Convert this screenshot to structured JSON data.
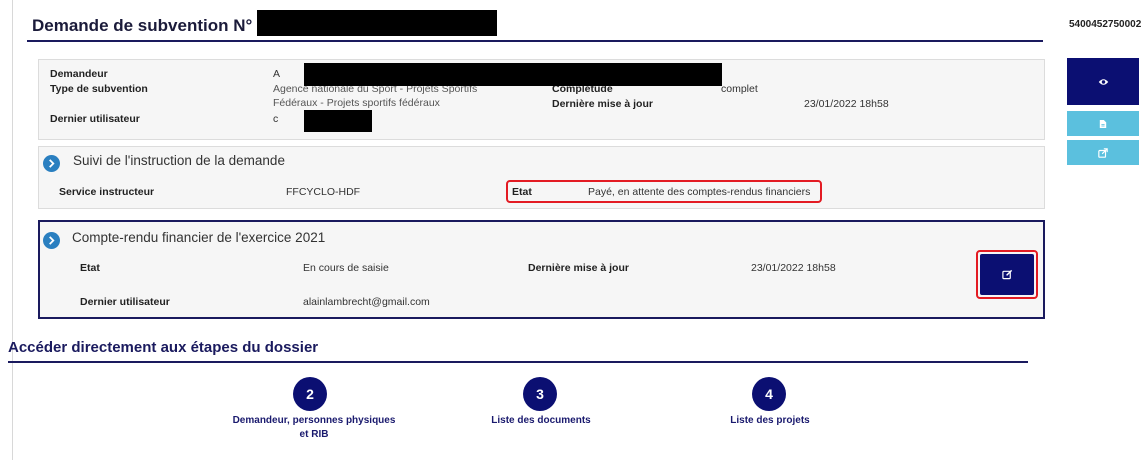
{
  "header": {
    "title": "Demande de subvention N° 2",
    "dossier_number": "5400452750002"
  },
  "summary": {
    "demandeur_label": "Demandeur",
    "demandeur_value": "A",
    "type_label": "Type de subvention",
    "type_value_line1": "Agence nationale du Sport - Projets Sportifs",
    "type_value_line2": "Fédéraux - Projets sportifs fédéraux",
    "completude_label": "Complétude",
    "completude_value": "complet",
    "maj_label": "Dernière mise à jour",
    "maj_value": "23/01/2022 18h58",
    "utilisateur_label": "Dernier utilisateur",
    "utilisateur_value": "c"
  },
  "instruction": {
    "title": "Suivi de l'instruction de la demande",
    "service_label": "Service instructeur",
    "service_value": "FFCYCLO-HDF",
    "etat_label": "Etat",
    "etat_value": "Payé, en attente des comptes-rendus financiers"
  },
  "compte_rendu": {
    "title": "Compte-rendu financier de l'exercice 2021",
    "etat_label": "Etat",
    "etat_value": "En cours de saisie",
    "maj_label": "Dernière mise à jour",
    "maj_value": "23/01/2022 18h58",
    "utilisateur_label": "Dernier utilisateur",
    "utilisateur_value": "alainlambrecht@gmail.com"
  },
  "steps": {
    "title": "Accéder directement aux étapes du dossier",
    "items": [
      {
        "number": "2",
        "label_line1": "Demandeur, personnes physiques",
        "label_line2": "et RIB"
      },
      {
        "number": "3",
        "label_line1": "Liste des documents",
        "label_line2": ""
      },
      {
        "number": "4",
        "label_line1": "Liste des projets",
        "label_line2": ""
      }
    ]
  },
  "icons": {
    "view": "eye-icon",
    "pdf": "document-icon",
    "external": "external-link-icon",
    "edit": "edit-icon"
  },
  "colors": {
    "navy": "#0b0f72",
    "light_blue": "#5bc0de",
    "highlight_red": "#e31b23",
    "chevron_blue": "#2a7fc0"
  }
}
